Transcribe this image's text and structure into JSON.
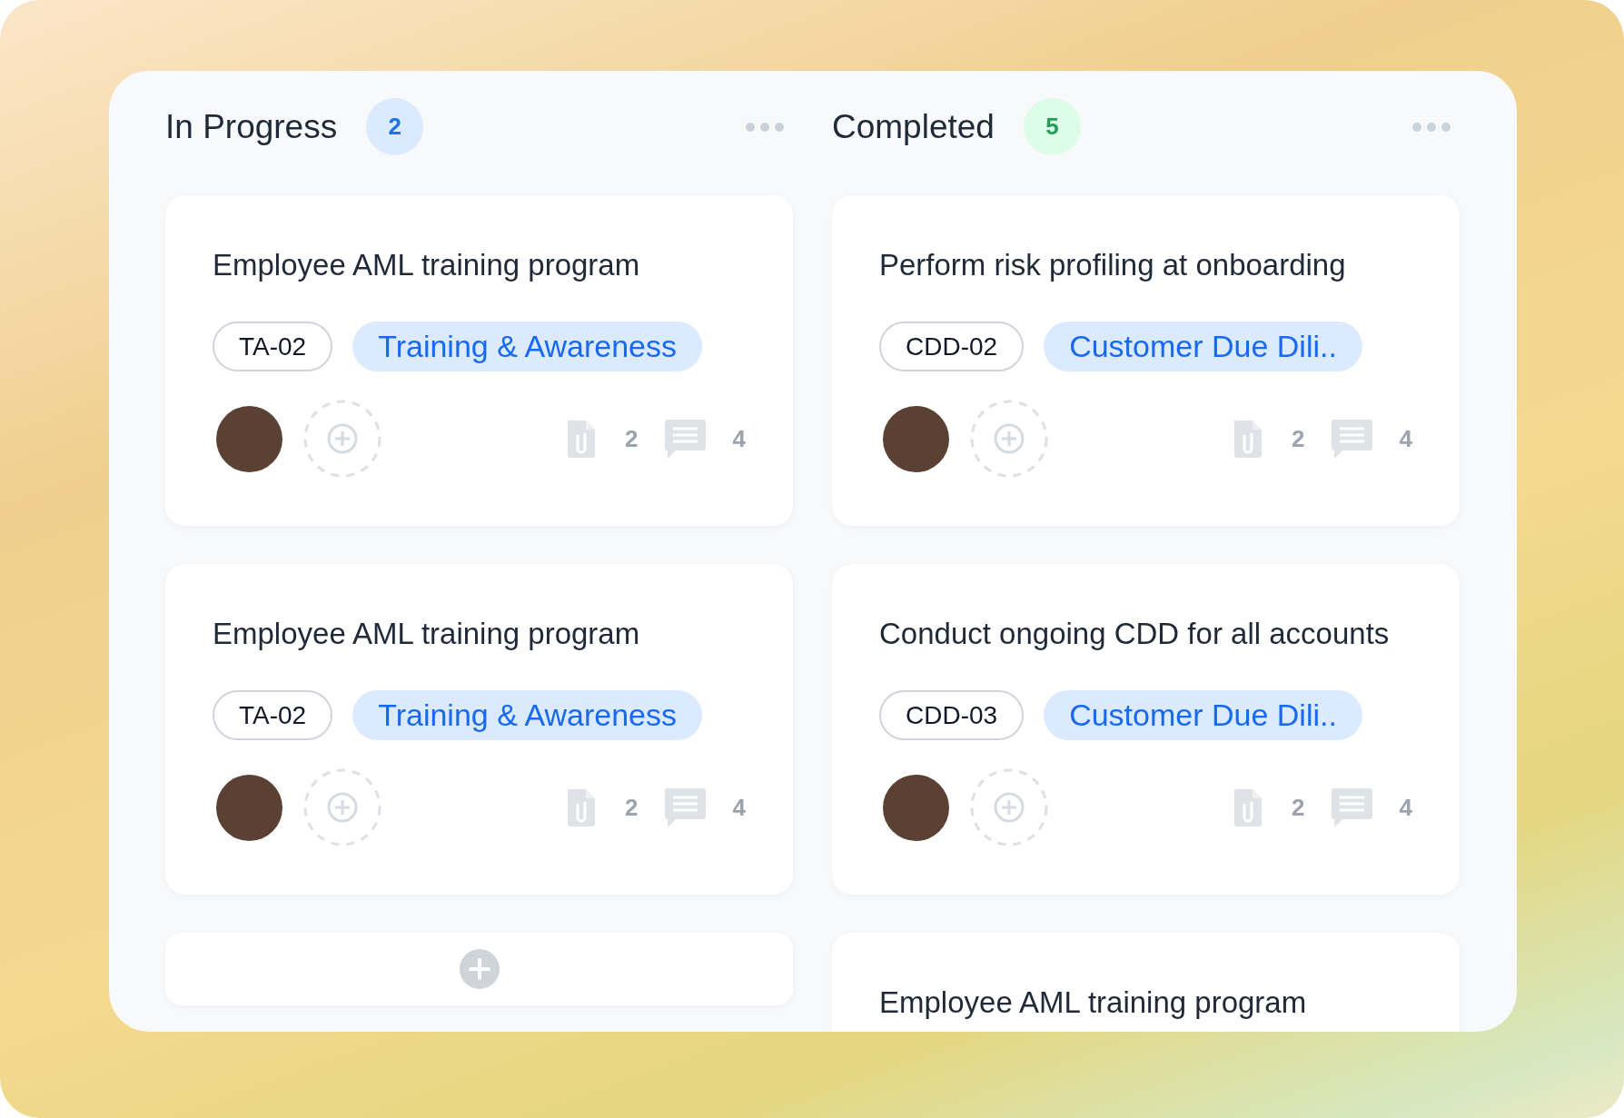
{
  "columns": [
    {
      "title": "In Progress",
      "count": "2",
      "color": "#1a73e8",
      "has_add_card": true,
      "cards": [
        {
          "title": "Employee AML training program",
          "code": "TA-02",
          "category": "Training & Awareness",
          "attachments": "2",
          "comments": "4"
        },
        {
          "title": "Employee AML training program",
          "code": "TA-02",
          "category": "Training & Awareness",
          "attachments": "2",
          "comments": "4"
        }
      ]
    },
    {
      "title": "Completed",
      "count": "5",
      "color": "#22a05a",
      "has_add_card": false,
      "cards": [
        {
          "title": "Perform risk profiling at onboarding",
          "code": "CDD-02",
          "category": "Customer Due Dili..",
          "attachments": "2",
          "comments": "4"
        },
        {
          "title": "Conduct ongoing CDD for all accounts",
          "code": "CDD-03",
          "category": "Customer Due Dili..",
          "attachments": "2",
          "comments": "4"
        },
        {
          "title": "Employee AML training program"
        }
      ]
    }
  ]
}
